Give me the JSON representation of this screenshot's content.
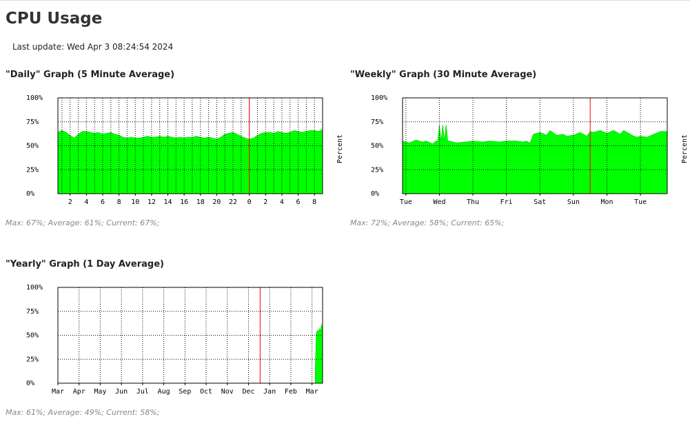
{
  "page": {
    "title": "CPU Usage",
    "last_update": "Last update: Wed Apr 3 08:24:54 2024"
  },
  "colors": {
    "fill": "#00ff00",
    "fill_edge": "#00cc00",
    "grid": "#000000",
    "marker": "#ff0000",
    "axis": "#000000"
  },
  "graphs": {
    "daily": {
      "title": "\"Daily\" Graph (5 Minute Average)",
      "stats": "Max: 67%; Average: 61%; Current: 67%;",
      "ylabel": "Percent"
    },
    "weekly": {
      "title": "\"Weekly\" Graph (30 Minute Average)",
      "stats": "Max: 72%; Average: 58%; Current: 65%;",
      "ylabel": "Percent"
    },
    "yearly": {
      "title": "\"Yearly\" Graph (1 Day Average)",
      "stats": "Max: 61%; Average: 49%; Current: 58%;"
    }
  },
  "chart_data": [
    {
      "id": "daily",
      "type": "area",
      "title": "\"Daily\" Graph (5 Minute Average)",
      "ylabel": "Percent",
      "ylim": [
        0,
        100
      ],
      "yticks": [
        "0%",
        "25%",
        "50%",
        "75%",
        "100%"
      ],
      "xlim": [
        0.5,
        33
      ],
      "xticks": [
        2,
        4,
        6,
        8,
        10,
        12,
        14,
        16,
        18,
        20,
        22,
        24,
        26,
        28,
        30,
        32
      ],
      "xtick_labels": [
        "2",
        "4",
        "6",
        "8",
        "10",
        "12",
        "14",
        "16",
        "18",
        "20",
        "22",
        "0",
        "2",
        "4",
        "6",
        "8"
      ],
      "grid_every": 1,
      "marker_x": 24,
      "x": [
        0.5,
        1,
        1.5,
        2,
        2.5,
        3,
        3.5,
        4,
        4.5,
        5,
        5.5,
        6,
        6.5,
        7,
        7.5,
        8,
        8.5,
        9,
        9.5,
        10,
        10.5,
        11,
        11.5,
        12,
        12.5,
        13,
        13.5,
        14,
        14.5,
        15,
        15.5,
        16,
        16.5,
        17,
        17.5,
        18,
        18.5,
        19,
        19.5,
        20,
        20.5,
        21,
        21.5,
        22,
        22.5,
        23,
        23.5,
        24,
        24.5,
        25,
        25.5,
        26,
        26.5,
        27,
        27.5,
        28,
        28.5,
        29,
        29.5,
        30,
        30.5,
        31,
        31.5,
        32,
        32.5,
        33
      ],
      "values": [
        64,
        66,
        64,
        61,
        58,
        62,
        65,
        65,
        64,
        63,
        64,
        62,
        63,
        64,
        62,
        61,
        59,
        58,
        59,
        58,
        58,
        59,
        60,
        59,
        59,
        60,
        59,
        60,
        59,
        58,
        59,
        58,
        59,
        59,
        60,
        59,
        58,
        59,
        58,
        57,
        59,
        62,
        63,
        64,
        62,
        60,
        58,
        57,
        58,
        61,
        63,
        64,
        64,
        63,
        65,
        64,
        63,
        64,
        66,
        65,
        64,
        65,
        66,
        66,
        65,
        67
      ]
    },
    {
      "id": "weekly",
      "type": "area",
      "title": "\"Weekly\" Graph (30 Minute Average)",
      "ylabel": "Percent",
      "ylim": [
        0,
        100
      ],
      "yticks": [
        "0%",
        "25%",
        "50%",
        "75%",
        "100%"
      ],
      "xlim": [
        -0.1,
        7.8
      ],
      "xticks": [
        0,
        1,
        2,
        3,
        4,
        5,
        6,
        7
      ],
      "xtick_labels": [
        "Tue",
        "Wed",
        "Thu",
        "Fri",
        "Sat",
        "Sun",
        "Mon",
        "Tue"
      ],
      "grid_every": 1,
      "marker_x": 5.5,
      "x": [
        -0.1,
        0.1,
        0.3,
        0.5,
        0.6,
        0.8,
        0.9,
        0.95,
        1.0,
        1.05,
        1.1,
        1.15,
        1.2,
        1.25,
        1.3,
        1.5,
        1.8,
        2.0,
        2.3,
        2.5,
        2.8,
        3.0,
        3.3,
        3.5,
        3.6,
        3.7,
        3.75,
        3.8,
        4.0,
        4.2,
        4.3,
        4.5,
        4.7,
        4.8,
        5.0,
        5.2,
        5.4,
        5.5,
        5.6,
        5.8,
        6.0,
        6.2,
        6.4,
        6.5,
        6.7,
        6.8,
        6.9,
        7.0,
        7.2,
        7.4,
        7.6,
        7.8
      ],
      "values": [
        55,
        53,
        56,
        54,
        55,
        52,
        55,
        55,
        72,
        55,
        72,
        55,
        72,
        55,
        55,
        53,
        54,
        55,
        54,
        55,
        54,
        55,
        55,
        54,
        55,
        53,
        57,
        62,
        64,
        61,
        66,
        61,
        62,
        60,
        61,
        64,
        60,
        65,
        64,
        66,
        63,
        66,
        62,
        66,
        62,
        60,
        59,
        60,
        59,
        62,
        65,
        65
      ]
    },
    {
      "id": "yearly",
      "type": "area",
      "title": "\"Yearly\" Graph (1 Day Average)",
      "ylim": [
        0,
        100
      ],
      "yticks": [
        "0%",
        "25%",
        "50%",
        "75%",
        "100%"
      ],
      "xlim": [
        0,
        12.5
      ],
      "xticks": [
        0,
        1,
        2,
        3,
        4,
        5,
        6,
        7,
        8,
        9,
        10,
        11,
        12
      ],
      "xtick_labels": [
        "Mar",
        "Apr",
        "May",
        "Jun",
        "Jul",
        "Aug",
        "Sep",
        "Oct",
        "Nov",
        "Dec",
        "Jan",
        "Feb",
        "Mar"
      ],
      "grid_every": 1,
      "marker_x": 9.55,
      "x": [
        12.15,
        12.2,
        12.25,
        12.3,
        12.35,
        12.4,
        12.45,
        12.5
      ],
      "values": [
        14,
        52,
        55,
        54,
        57,
        55,
        61,
        58
      ]
    }
  ]
}
